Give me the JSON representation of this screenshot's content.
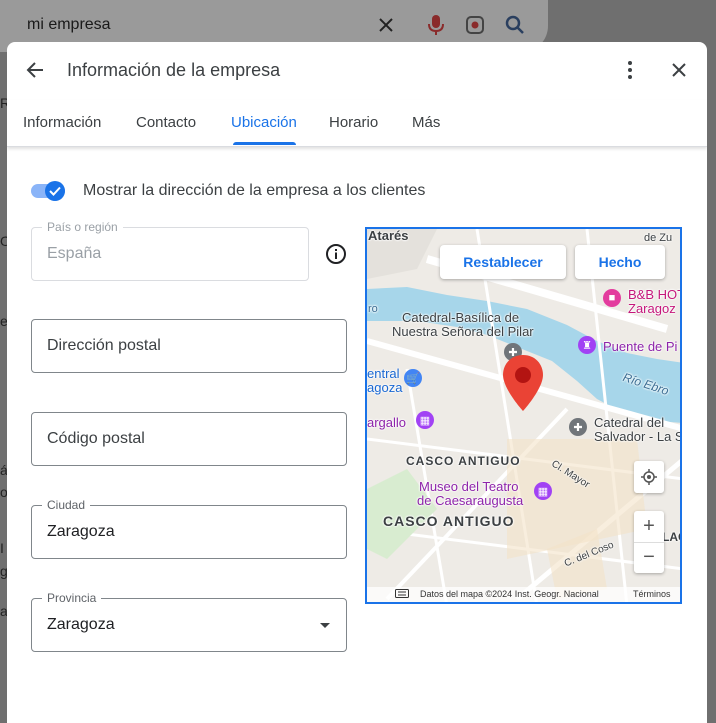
{
  "background": {
    "search_query": "mi empresa",
    "side_letters": [
      "R",
      "O",
      "e",
      "á",
      "o",
      "I",
      "g",
      "a"
    ]
  },
  "dialog": {
    "title": "Información de la empresa",
    "tabs": [
      {
        "label": "Información"
      },
      {
        "label": "Contacto"
      },
      {
        "label": "Ubicación"
      },
      {
        "label": "Horario"
      },
      {
        "label": "Más"
      }
    ],
    "active_tab": "Ubicación",
    "toggle_label": "Mostrar la dirección de la empresa a los clientes",
    "toggle_on": true,
    "fields": {
      "country": {
        "label": "País o región",
        "value": "España"
      },
      "address": {
        "placeholder": "Dirección postal"
      },
      "postal": {
        "placeholder": "Código postal"
      },
      "city": {
        "label": "Ciudad",
        "value": "Zaragoza"
      },
      "province": {
        "label": "Provincia",
        "value": "Zaragoza"
      }
    }
  },
  "map": {
    "reset_label": "Restablecer",
    "done_label": "Hecho",
    "labels": {
      "atares": "Atarés",
      "top_right": "de Zu",
      "hotel": "B&B HOT",
      "hotel2": "Zaragoz",
      "ro": "ro",
      "basilica1": "Catedral-Basílica de",
      "basilica2": "Nuestra Señora del Pilar",
      "puente": "Puente de Pi",
      "central1": "entral",
      "central2": "agoza",
      "rio": "Río Ebro",
      "gargallo": "argallo",
      "salvador1": "Catedral del",
      "salvador2": "Salvador - La S",
      "casco_small": "CASCO ANTIGUO",
      "mayor": "Cl. Mayor",
      "museo1": "Museo del Teatro",
      "museo2": "de Caesaraugusta",
      "casco_big": "CASCO ANTIGUO",
      "right_edge": "LAC",
      "coso": "C. del Coso"
    },
    "footer_data": "Datos del mapa ©2024 Inst. Geogr. Nacional",
    "footer_terms": "Términos",
    "colors": {
      "water": "#a7d6ea",
      "pin": "#ea4335",
      "poi_purple": "#a142f4",
      "poi_blue": "#4285f4",
      "poi_gray": "#70757a",
      "accent": "#1a73e8"
    }
  }
}
